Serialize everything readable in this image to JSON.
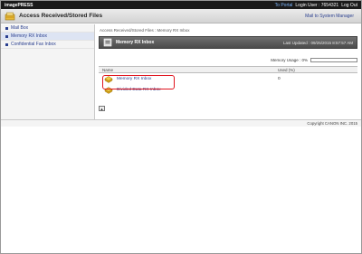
{
  "topbar": {
    "brand": "imagePRESS",
    "portal_link": "To Portal",
    "login_label": "Login User : 7654321",
    "logout_link": "Log Out"
  },
  "titlebar": {
    "title": "Access Received/Stored Files",
    "return_link": "Mail to System Manager"
  },
  "sidebar": {
    "items": [
      {
        "label": "Mail Box",
        "active": false
      },
      {
        "label": "Memory RX Inbox",
        "active": true
      },
      {
        "label": "Confidential Fax Inbox",
        "active": false
      }
    ]
  },
  "main": {
    "breadcrumb": "Access Received/Stored Files : Memory RX Inbox",
    "panel_title": "Memory RX Inbox",
    "last_updated": "Last Updated : 09/25/2015 8:57:57 AM",
    "usage_label": "Memory Usage : 0%",
    "usage_percent": 0,
    "columns": {
      "name": "Name",
      "used": "Used (%)"
    },
    "rows": [
      {
        "name": "Memory RX Inbox",
        "used": "0"
      },
      {
        "name": "Divided Data RX Inbox",
        "used": ""
      }
    ],
    "scroll_top_glyph": "▲"
  },
  "footer": {
    "copyright": "Copyright CANON INC. 2015"
  },
  "colors": {
    "link": "#2a3f8f",
    "highlight": "#e0141e",
    "header_dark": "#1a1a1a"
  }
}
